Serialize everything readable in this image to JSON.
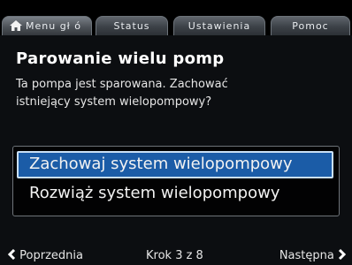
{
  "tabs": [
    {
      "label": "Menu gł ó",
      "icon": "home-icon",
      "active": true
    },
    {
      "label": "Status"
    },
    {
      "label": "Ustawienia"
    },
    {
      "label": "Pomoc"
    }
  ],
  "title": "Parowanie wielu pomp",
  "description": {
    "line1": "Ta pompa jest sparowana. Zachować",
    "line2": "istniejący system wielopompowy?"
  },
  "options": [
    {
      "label": "Zachowaj system wielopompowy",
      "selected": true
    },
    {
      "label": "Rozwiąż system wielopompowy",
      "selected": false
    }
  ],
  "footer": {
    "prev": "Poprzednia",
    "step": "Krok 3 z 8",
    "next": "Następna"
  },
  "colors": {
    "selection": "#1b5ca7",
    "background": "#0c0e11"
  }
}
